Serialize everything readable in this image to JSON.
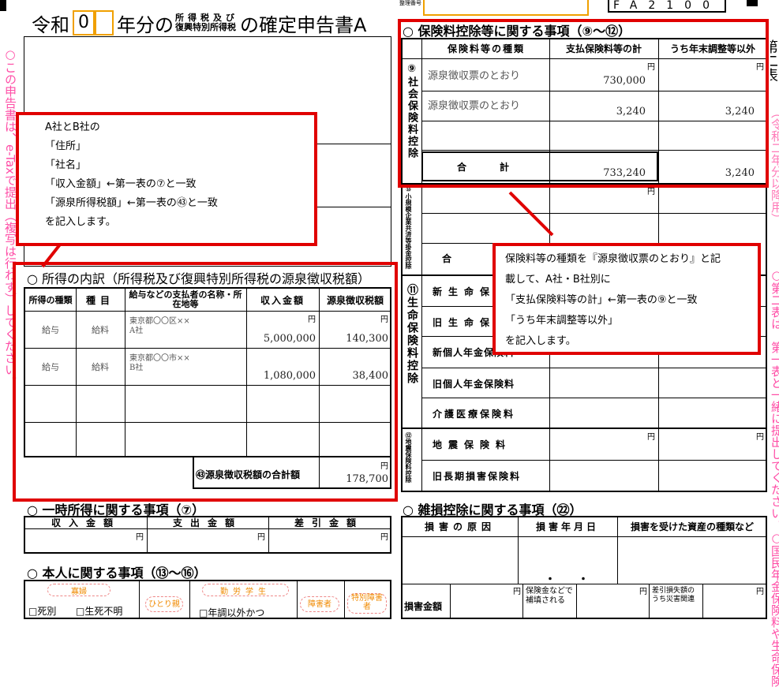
{
  "header": {
    "title_prefix": "令和",
    "year": "0",
    "title_mid": "年分の",
    "tax_line1": "所得税及び",
    "tax_line2": "復興特別所得税",
    "title_suffix": "の確定申告書A",
    "form_code": "FA2100",
    "id_label": "整理番号"
  },
  "insurance": {
    "section_title": "○ 保険料控除等に関する事項（⑨～⑫）",
    "col_type": "保険料等の種類",
    "col_paid": "支払保険料等の計",
    "col_excl": "うち年末調整等以外",
    "yen": "円",
    "social_label": "⑨社会保険料控除",
    "social_rows": [
      {
        "type": "源泉徴収票のとおり",
        "paid": "730,000",
        "excl": ""
      },
      {
        "type": "源泉徴収票のとおり",
        "paid": "3,240",
        "excl": "3,240"
      }
    ],
    "total_label": "合　　計",
    "total_paid": "733,240",
    "total_excl": "3,240",
    "small_label": "⑩小規模企業共済等掛金控除",
    "small_total": "合",
    "life_label": "⑪生命保険料控除",
    "life_rows": [
      "新生命保険料",
      "旧生命保険料",
      "新個人年金保険料",
      "旧個人年金保険料",
      "介護医療保険料"
    ],
    "quake_label": "⑫地震保険料控除",
    "quake_rows": [
      "地震保険料",
      "旧長期損害保険料"
    ]
  },
  "income": {
    "section_title": "○ 所得の内訳（所得税及び復興特別所得税の源泉徴収税額）",
    "col_kind": "所得の種類",
    "col_item": "種目",
    "col_payer": "給与などの支払者の名称・所在地等",
    "col_amount": "収入金額",
    "col_withheld": "源泉徴収税額",
    "yen": "円",
    "rows": [
      {
        "kind": "給与",
        "item": "給料",
        "payer_addr": "東京都〇〇区××",
        "payer_name": "A社",
        "amount": "5,000,000",
        "withheld": "140,300"
      },
      {
        "kind": "給与",
        "item": "給料",
        "payer_addr": "東京都〇〇市××",
        "payer_name": "B社",
        "amount": "1,080,000",
        "withheld": "38,400"
      }
    ],
    "total_label": "㊸源泉徴収税額の合計額",
    "total_value": "178,700"
  },
  "temporary": {
    "section_title": "○ 一時所得に関する事項（⑦）",
    "col_income": "収入金額",
    "col_expense": "支出金額",
    "col_diff": "差引金額",
    "yen": "円"
  },
  "personal": {
    "section_title": "○ 本人に関する事項（⑬～⑯）",
    "widow": "寡婦",
    "single_parent": "ひとり親",
    "working_student": "勤労学生",
    "disabled": "障害者",
    "special_disabled": "特別障害者",
    "death": "□死別",
    "unknown": "□生死不明",
    "annual": "□年調以外かつ"
  },
  "casualty": {
    "section_title": "○ 雑損控除に関する事項（㉒）",
    "col_cause": "損害の原因",
    "col_date": "損害年月日",
    "col_asset": "損害を受けた資産の種類など",
    "loss_amount": "損害金額",
    "insurance_comp": "保険金などで補填される",
    "disaster_expense": "差引損失額のうち災害関連",
    "yen": "円",
    "date_dots": "・　　・"
  },
  "callout_left": {
    "lines": [
      "A社とB社の",
      "「住所」",
      "「社名」",
      "「収入金額」←第一表の⑦と一致",
      "「源泉所得税額」←第一表の㊸と一致",
      "を記入します。"
    ]
  },
  "callout_right": {
    "lines": [
      "保険料等の種類を『源泉徴収票のとおり』と記",
      "載して、A社・B社別に",
      "「支払保険料等の計」←第一表の⑨と一致",
      "「うち年末調整等以外」",
      "を記入します。"
    ]
  },
  "margin_left": "○この申告書は、e-Taxで提出（複写は行わず）してください。",
  "margin_right_top": "第二表",
  "margin_right_sub": "（令和二年分以降用）",
  "margin_right_note": "○第二表は、第一表と一緒に提出してください。○国民年金保険料や生命保険"
}
